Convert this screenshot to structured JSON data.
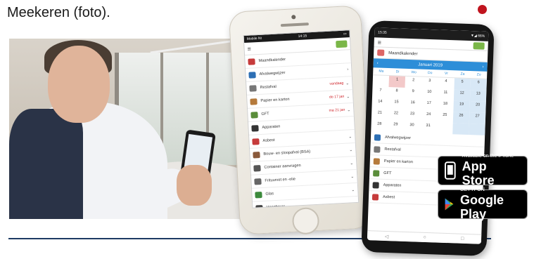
{
  "caption": "Meekeren (foto).",
  "colors": {
    "accent": "#c0141e",
    "rule": "#1d3a63",
    "calendar_blue": "#2d8ed8",
    "date_red": "#d0282e"
  },
  "photo": {
    "icon": "person-with-phone-photo"
  },
  "iphone": {
    "status_left": "Mobile Nt",
    "status_time": "14:15",
    "rows": [
      {
        "label": "Maandkalender",
        "date": "",
        "chevron": "",
        "icon_color": "#c63b3b"
      },
      {
        "label": "Afvalwegwijzer",
        "date": "",
        "chevron": "›",
        "icon_color": "#2d6fb4"
      },
      {
        "label": "Restafval",
        "date": "vandaag",
        "chevron": "⌄",
        "icon_color": "#777777"
      },
      {
        "label": "Papier en karton",
        "date": "do 17 jan",
        "chevron": "⌄",
        "icon_color": "#b57a3b"
      },
      {
        "label": "GFT",
        "date": "ma 21 jan",
        "chevron": "⌄",
        "icon_color": "#5a8d3a"
      },
      {
        "label": "Apparaten",
        "date": "",
        "chevron": "",
        "icon_color": "#333333"
      },
      {
        "label": "Asbest",
        "date": "",
        "chevron": "⌄",
        "icon_color": "#c63b3b"
      },
      {
        "label": "Bouw- en sloopafval (BSA)",
        "date": "",
        "chevron": "⌄",
        "icon_color": "#8a5a3b"
      },
      {
        "label": "Container aanvragen",
        "date": "",
        "chevron": "⌄",
        "icon_color": "#555555"
      },
      {
        "label": "Frituurvet en -olie",
        "date": "",
        "chevron": "⌄",
        "icon_color": "#666666"
      },
      {
        "label": "Glas",
        "date": "",
        "chevron": "⌄",
        "icon_color": "#3c8a3c"
      },
      {
        "label": "Hoogbouw",
        "date": "",
        "chevron": "⌄",
        "icon_color": "#444444"
      }
    ]
  },
  "android": {
    "status_left": "15:35",
    "status_right": "▼◢ 66%",
    "title": "Maandkalender",
    "month": "Januari 2019",
    "prev": "‹",
    "next": "›",
    "days": [
      "Ma",
      "Di",
      "Wo",
      "Do",
      "Vr",
      "Za",
      "Zo"
    ],
    "weeks": [
      [
        "",
        "1",
        "2",
        "3",
        "4",
        "5",
        "6"
      ],
      [
        "7",
        "8",
        "9",
        "10",
        "11",
        "12",
        "13"
      ],
      [
        "14",
        "15",
        "16",
        "17",
        "18",
        "19",
        "20"
      ],
      [
        "21",
        "22",
        "23",
        "24",
        "25",
        "26",
        "27"
      ],
      [
        "28",
        "29",
        "30",
        "31",
        "",
        "",
        ""
      ]
    ],
    "rows": [
      {
        "label": "Afvalwegwijzer",
        "icon_color": "#2d6fb4"
      },
      {
        "label": "Restafval",
        "icon_color": "#777777"
      },
      {
        "label": "Papier en karton",
        "icon_color": "#b57a3b"
      },
      {
        "label": "GFT",
        "icon_color": "#5a8d3a"
      },
      {
        "label": "Apparaten",
        "icon_color": "#333333"
      },
      {
        "label": "Asbest",
        "icon_color": "#c63b3b"
      }
    ],
    "nav": [
      "◁",
      "○",
      "□"
    ]
  },
  "badges": {
    "appstore": {
      "small": "Available on the iPhone",
      "big": "App Store",
      "icon": "iphone-icon"
    },
    "gplay": {
      "small": "GET IT ON",
      "big": "Google Play",
      "icon": "google-play-icon"
    }
  }
}
